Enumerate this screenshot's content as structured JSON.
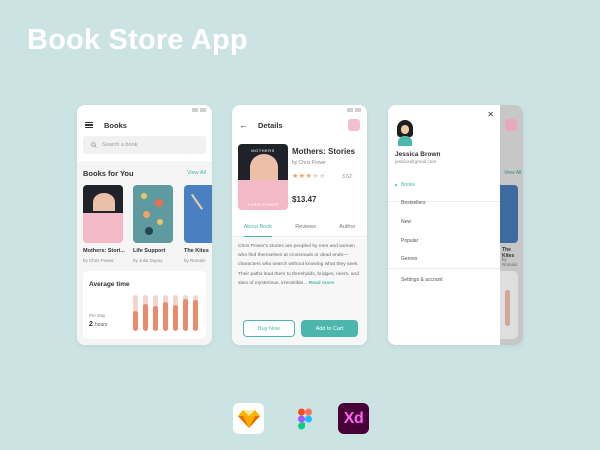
{
  "title": "Book Store App",
  "screen_home": {
    "header": "Books",
    "search_placeholder": "Search a book",
    "section_title": "Books for You",
    "view_all": "View All",
    "books": [
      {
        "title": "Mothers: Stori...",
        "author": "by Chris Power"
      },
      {
        "title": "Life Support",
        "author": "by Julia Dupuy"
      },
      {
        "title": "The Kites",
        "author": "by Romain"
      }
    ],
    "avg_card": {
      "title": "Average time",
      "per_day_label": "Per Day",
      "hours_value": "2",
      "hours_unit": "hours",
      "bar_levels": [
        0.55,
        0.75,
        0.7,
        0.8,
        0.72,
        0.88,
        0.85
      ]
    }
  },
  "screen_details": {
    "header": "Details",
    "cover_title": "MOTHERS",
    "cover_author": "CHRIS POWER",
    "book_title": "Mothers: Stories",
    "author": "by Chris Power",
    "stars_on": "★★★",
    "stars_off": "★★",
    "rating": "3.62",
    "price": "$13.47",
    "tabs": [
      "About Book",
      "Reviews",
      "Author"
    ],
    "description": "Chris Power's stories are peopled by men and women who find themselves at crossroads or dead ends—characters who search without knowing what they seek. Their paths lead them to thresholds, bridges, rivers, and sites of mysterious, irresistible...",
    "read_more": "Read more",
    "buy_now": "Buy Now",
    "add_to_cart": "Add to Cart"
  },
  "screen_menu": {
    "user_name": "Jessica Brown",
    "user_email": "jessica@gmail.com",
    "menu_items": [
      "Books",
      "Bestsellers",
      "New",
      "Popular",
      "Genres"
    ],
    "settings": "Settings & account",
    "under_view_all": "View All",
    "under_book_title": "The Kites",
    "under_book_author": "by Romain"
  },
  "tools": {
    "xd_label": "Xd"
  },
  "colors": {
    "background": "#cce3e3",
    "accent": "#4db6ac",
    "bar_fill": "#e98b6c"
  }
}
